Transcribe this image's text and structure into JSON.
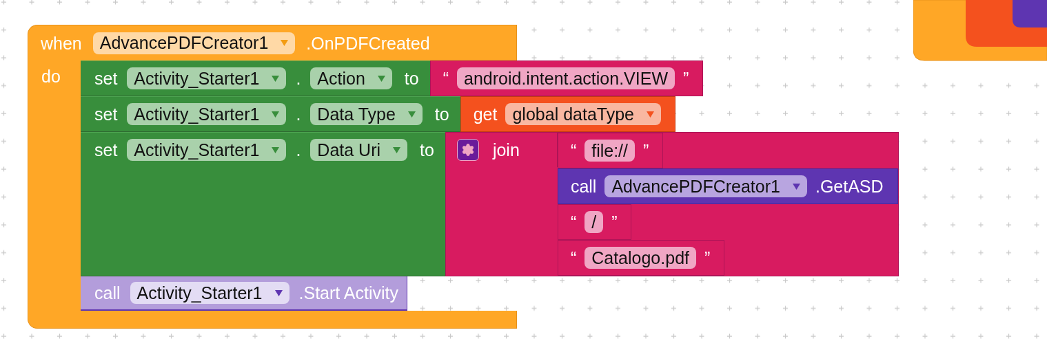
{
  "event": {
    "keyword": "when",
    "component": "AdvancePDFCreator1",
    "name": ".OnPDFCreated",
    "do_label": "do",
    "statements": [
      {
        "kind": "set",
        "keyword": "set",
        "component": "Activity_Starter1",
        "dot": ".",
        "property": "Action",
        "to_label": "to",
        "value": {
          "kind": "text",
          "open_quote": "“",
          "text": "android.intent.action.VIEW",
          "close_quote": "”"
        }
      },
      {
        "kind": "set",
        "keyword": "set",
        "component": "Activity_Starter1",
        "dot": ".",
        "property": "Data Type",
        "to_label": "to",
        "value": {
          "kind": "get",
          "keyword": "get",
          "variable": "global dataType"
        }
      },
      {
        "kind": "set",
        "keyword": "set",
        "component": "Activity_Starter1",
        "dot": ".",
        "property": "Data Uri",
        "to_label": "to",
        "value": {
          "kind": "join",
          "keyword": "join",
          "items": [
            {
              "kind": "text",
              "open_quote": "“",
              "text": "file://",
              "close_quote": "”"
            },
            {
              "kind": "call",
              "keyword": "call",
              "component": "AdvancePDFCreator1",
              "method": ".GetASD"
            },
            {
              "kind": "text",
              "open_quote": "“",
              "text": "/",
              "close_quote": "”"
            },
            {
              "kind": "text",
              "open_quote": "“",
              "text": "Catalogo.pdf",
              "close_quote": "”"
            }
          ]
        }
      },
      {
        "kind": "call",
        "keyword": "call",
        "component": "Activity_Starter1",
        "method": ".Start Activity"
      }
    ]
  }
}
